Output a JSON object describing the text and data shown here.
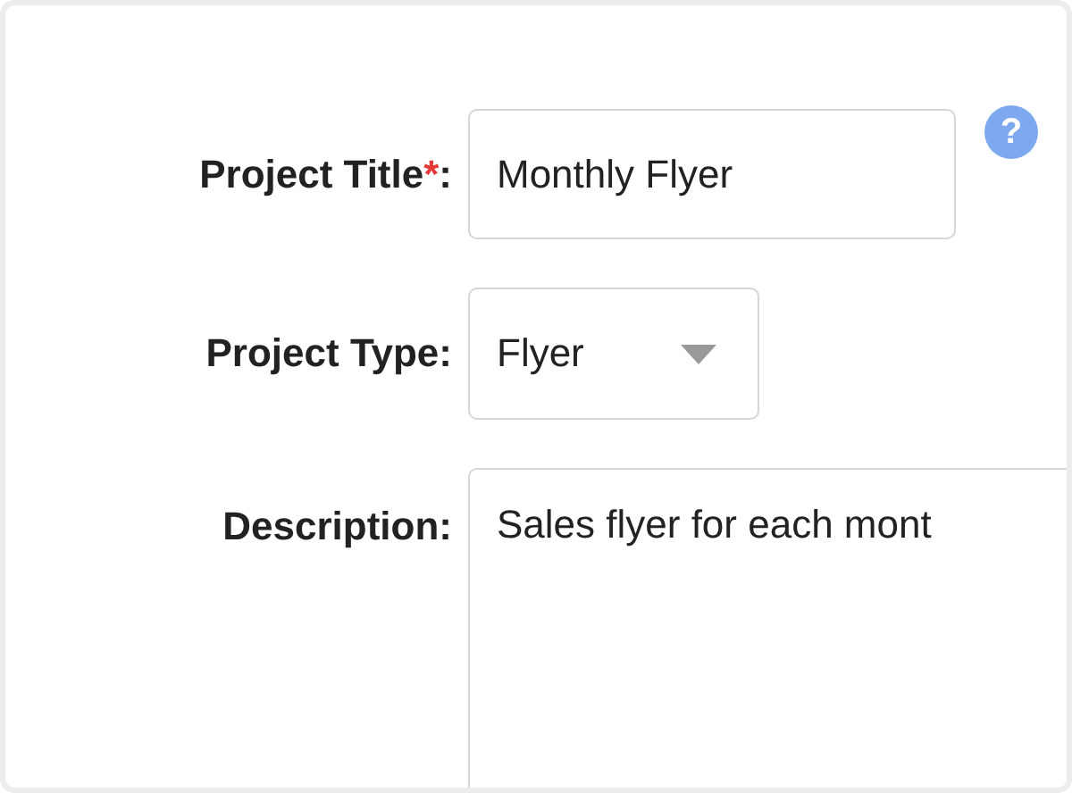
{
  "fields": [
    {
      "kind": "text",
      "label": "Project Title",
      "required_mark": "*",
      "label_suffix": ":",
      "value": "Monthly Flyer",
      "help": "?"
    },
    {
      "kind": "select",
      "label": "Project Type:",
      "value": "Flyer"
    },
    {
      "kind": "textarea",
      "label": "Description:",
      "value": "Sales flyer for each mont"
    }
  ]
}
